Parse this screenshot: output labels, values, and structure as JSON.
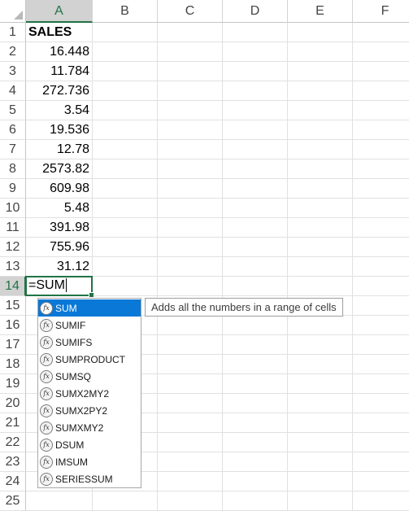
{
  "columns": [
    "A",
    "B",
    "C",
    "D",
    "E",
    "F"
  ],
  "rows": [
    "1",
    "2",
    "3",
    "4",
    "5",
    "6",
    "7",
    "8",
    "9",
    "10",
    "11",
    "12",
    "13",
    "14",
    "15",
    "16",
    "17",
    "18",
    "19",
    "20",
    "21",
    "22",
    "23",
    "24",
    "25"
  ],
  "sales": {
    "header": "SALES",
    "values": [
      "16.448",
      "11.784",
      "272.736",
      "3.54",
      "19.536",
      "12.78",
      "2573.82",
      "609.98",
      "5.48",
      "391.98",
      "755.96",
      "31.12"
    ]
  },
  "active_cell": {
    "ref": "A14",
    "formula": "=SUM"
  },
  "autocomplete": {
    "items": [
      "SUM",
      "SUMIF",
      "SUMIFS",
      "SUMPRODUCT",
      "SUMSQ",
      "SUMX2MY2",
      "SUMX2PY2",
      "SUMXMY2",
      "DSUM",
      "IMSUM",
      "SERIESSUM"
    ],
    "selected_index": 0,
    "icon": "function-fx-icon",
    "icon_glyph": "fx"
  },
  "tooltip": {
    "text": "Adds all the numbers in a range of cells"
  },
  "colors": {
    "accent": "#217346",
    "selection": "#0a78d7",
    "gridline": "#e1e1e1"
  }
}
